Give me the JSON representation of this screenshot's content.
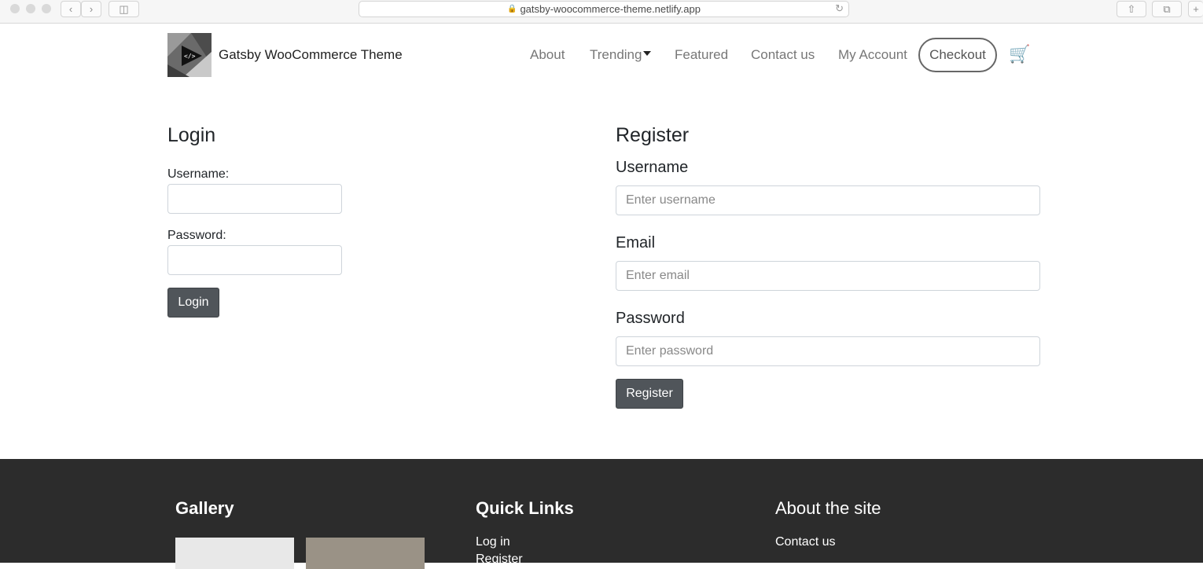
{
  "browser": {
    "url": "gatsby-woocommerce-theme.netlify.app"
  },
  "navbar": {
    "brand": "Gatsby WooCommerce Theme",
    "links": [
      "About",
      "Trending",
      "Featured",
      "Contact us",
      "My Account"
    ],
    "checkout": "Checkout",
    "cart_icon": "cart-icon"
  },
  "login": {
    "title": "Login",
    "username_label": "Username:",
    "password_label": "Password:",
    "button": "Login"
  },
  "register": {
    "title": "Register",
    "username_label": "Username",
    "username_placeholder": "Enter username",
    "email_label": "Email",
    "email_placeholder": "Enter email",
    "password_label": "Password",
    "password_placeholder": "Enter password",
    "button": "Register"
  },
  "footer": {
    "gallery_title": "Gallery",
    "quick_links_title": "Quick Links",
    "quick_links": [
      "Log in",
      "Register"
    ],
    "about_title": "About the site",
    "about_links": [
      "Contact us"
    ]
  },
  "colors": {
    "button_dark": "#50555a",
    "footer_bg": "#2c2c2c"
  }
}
